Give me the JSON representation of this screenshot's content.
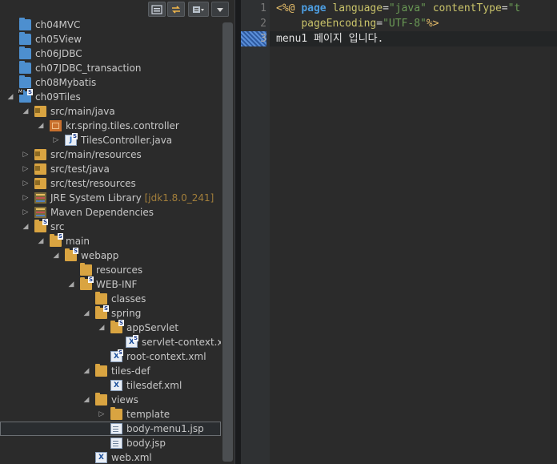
{
  "explorer": {
    "toolbar": [
      {
        "icon": "collapse-all-icon"
      },
      {
        "icon": "link-with-editor-icon"
      },
      {
        "icon": "view-menu-icon"
      },
      {
        "icon": "chevron-down-icon"
      }
    ],
    "tree": [
      {
        "name": "tree-item-ch04mvc",
        "label": "ch04MVC",
        "depth": 0,
        "toggle": "",
        "icon": "project"
      },
      {
        "name": "tree-item-ch05view",
        "label": "ch05View",
        "depth": 0,
        "toggle": "",
        "icon": "project"
      },
      {
        "name": "tree-item-ch06jdbc",
        "label": "ch06JDBC",
        "depth": 0,
        "toggle": "",
        "icon": "project"
      },
      {
        "name": "tree-item-ch07jdbc-transaction",
        "label": "ch07JDBC_transaction",
        "depth": 0,
        "toggle": "",
        "icon": "project"
      },
      {
        "name": "tree-item-ch08mybatis",
        "label": "ch08Mybatis",
        "depth": 0,
        "toggle": "",
        "icon": "project"
      },
      {
        "name": "tree-item-ch09tiles",
        "label": "ch09Tiles",
        "depth": 0,
        "toggle": "◢",
        "icon": "project-spring"
      },
      {
        "name": "tree-item-src-main-java",
        "label": "src/main/java",
        "depth": 1,
        "toggle": "◢",
        "icon": "srcfolder"
      },
      {
        "name": "tree-item-package",
        "label": "kr.spring.tiles.controller",
        "depth": 2,
        "toggle": "◢",
        "icon": "package"
      },
      {
        "name": "tree-item-tilescontroller",
        "label": "TilesController.java",
        "depth": 3,
        "toggle": "▷",
        "icon": "java"
      },
      {
        "name": "tree-item-src-main-resources",
        "label": "src/main/resources",
        "depth": 1,
        "toggle": "▷",
        "icon": "srcfolder"
      },
      {
        "name": "tree-item-src-test-java",
        "label": "src/test/java",
        "depth": 1,
        "toggle": "▷",
        "icon": "srcfolder"
      },
      {
        "name": "tree-item-src-test-resources",
        "label": "src/test/resources",
        "depth": 1,
        "toggle": "▷",
        "icon": "srcfolder"
      },
      {
        "name": "tree-item-jre",
        "label": "JRE System Library",
        "decor": "[jdk1.8.0_241]",
        "depth": 1,
        "toggle": "▷",
        "icon": "lib"
      },
      {
        "name": "tree-item-maven",
        "label": "Maven Dependencies",
        "depth": 1,
        "toggle": "▷",
        "icon": "lib"
      },
      {
        "name": "tree-item-src",
        "label": "src",
        "depth": 1,
        "toggle": "◢",
        "icon": "folder-spring"
      },
      {
        "name": "tree-item-main",
        "label": "main",
        "depth": 2,
        "toggle": "◢",
        "icon": "folder-spring"
      },
      {
        "name": "tree-item-webapp",
        "label": "webapp",
        "depth": 3,
        "toggle": "◢",
        "icon": "folder-spring"
      },
      {
        "name": "tree-item-resources",
        "label": "resources",
        "depth": 4,
        "toggle": "",
        "icon": "folder"
      },
      {
        "name": "tree-item-web-inf",
        "label": "WEB-INF",
        "depth": 4,
        "toggle": "◢",
        "icon": "folder-spring"
      },
      {
        "name": "tree-item-classes",
        "label": "classes",
        "depth": 5,
        "toggle": "",
        "icon": "folder"
      },
      {
        "name": "tree-item-spring",
        "label": "spring",
        "depth": 5,
        "toggle": "◢",
        "icon": "folder-spring"
      },
      {
        "name": "tree-item-appservlet",
        "label": "appServlet",
        "depth": 6,
        "toggle": "◢",
        "icon": "folder-spring"
      },
      {
        "name": "tree-item-servlet-context",
        "label": "servlet-context.xml",
        "depth": 7,
        "toggle": "",
        "icon": "xml-spring"
      },
      {
        "name": "tree-item-root-context",
        "label": "root-context.xml",
        "depth": 6,
        "toggle": "",
        "icon": "xml-spring"
      },
      {
        "name": "tree-item-tiles-def",
        "label": "tiles-def",
        "depth": 5,
        "toggle": "◢",
        "icon": "folder"
      },
      {
        "name": "tree-item-tilesdef-xml",
        "label": "tilesdef.xml",
        "depth": 6,
        "toggle": "",
        "icon": "xml"
      },
      {
        "name": "tree-item-views",
        "label": "views",
        "depth": 5,
        "toggle": "◢",
        "icon": "folder"
      },
      {
        "name": "tree-item-template",
        "label": "template",
        "depth": 6,
        "toggle": "▷",
        "icon": "folder"
      },
      {
        "name": "tree-item-body-menu1",
        "label": "body-menu1.jsp",
        "depth": 6,
        "toggle": "",
        "icon": "file",
        "selected": true
      },
      {
        "name": "tree-item-body",
        "label": "body.jsp",
        "depth": 6,
        "toggle": "",
        "icon": "file"
      },
      {
        "name": "tree-item-web-xml",
        "label": "web.xml",
        "depth": 5,
        "toggle": "",
        "icon": "xml"
      }
    ]
  },
  "editor": {
    "line_numbers": [
      "1",
      "2",
      "3"
    ],
    "lines": [
      [
        {
          "t": "<%@ ",
          "c": "tag"
        },
        {
          "t": "page",
          "c": "kw"
        },
        {
          "t": " ",
          "c": "eq"
        },
        {
          "t": "language",
          "c": "attr"
        },
        {
          "t": "=",
          "c": "eq"
        },
        {
          "t": "\"java\"",
          "c": "str"
        },
        {
          "t": " ",
          "c": "eq"
        },
        {
          "t": "contentType",
          "c": "attr"
        },
        {
          "t": "=",
          "c": "eq"
        },
        {
          "t": "\"t",
          "c": "str"
        }
      ],
      [
        {
          "t": "    ",
          "c": "eq"
        },
        {
          "t": "pageEncoding",
          "c": "attr"
        },
        {
          "t": "=",
          "c": "eq"
        },
        {
          "t": "\"UTF-8\"",
          "c": "str"
        },
        {
          "t": "%>",
          "c": "tag"
        }
      ],
      [
        {
          "t": "menu1 페이지 입니다.",
          "c": "text"
        }
      ]
    ],
    "current_line": 3
  }
}
